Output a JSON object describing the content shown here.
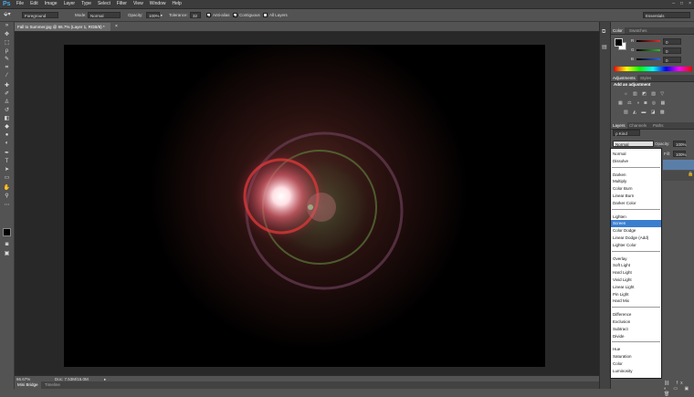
{
  "app": {
    "logo": "Ps"
  },
  "menu": [
    "File",
    "Edit",
    "Image",
    "Layer",
    "Type",
    "Select",
    "Filter",
    "View",
    "Window",
    "Help"
  ],
  "window_controls": [
    "–",
    "□",
    "×"
  ],
  "options": {
    "source_value": "Foreground",
    "mode_label": "Mode:",
    "mode_value": "Normal",
    "opacity_label": "Opacity:",
    "opacity_value": "100%",
    "tolerance_label": "Tolerance:",
    "tolerance_value": "32",
    "antialias_label": "Anti-alias",
    "contiguous_label": "Contiguous",
    "all_layers_label": "All Layers",
    "workspace_value": "Essentials"
  },
  "document": {
    "tab_title": "Fall to Summer.jpg @ 66.7% (Layer 1, RGB/8) *",
    "zoom": "66.67%",
    "doc_info": "Doc: 7.53M/15.0M"
  },
  "bottom_tabs": [
    "Mini Bridge",
    "Timeline"
  ],
  "color_panel": {
    "tabs": [
      "Color",
      "Swatches"
    ],
    "channels": [
      {
        "label": "R",
        "value": "0",
        "color": "#e03030"
      },
      {
        "label": "G",
        "value": "0",
        "color": "#30c030"
      },
      {
        "label": "B",
        "value": "0",
        "color": "#3060e0"
      }
    ]
  },
  "adjustments_panel": {
    "tabs": [
      "Adjustments",
      "Styles"
    ],
    "heading": "Add an adjustment"
  },
  "layers_panel": {
    "tabs": [
      "Layers",
      "Channels",
      "Paths"
    ],
    "kind_value": "ρ Kind",
    "blend_value": "Normal",
    "opacity_label": "Opacity:",
    "opacity_value": "100%",
    "fill_label": "Fill:",
    "fill_value": "100%"
  },
  "blend_modes": {
    "groups": [
      [
        "Normal",
        "Dissolve"
      ],
      [
        "Darken",
        "Multiply",
        "Color Burn",
        "Linear Burn",
        "Darker Color"
      ],
      [
        "Lighten",
        "Screen",
        "Color Dodge",
        "Linear Dodge (Add)",
        "Lighter Color"
      ],
      [
        "Overlay",
        "Soft Light",
        "Hard Light",
        "Vivid Light",
        "Linear Light",
        "Pin Light",
        "Hard Mix"
      ],
      [
        "Difference",
        "Exclusion",
        "Subtract",
        "Divide"
      ],
      [
        "Hue",
        "Saturation",
        "Color",
        "Luminosity"
      ]
    ],
    "selected": "Screen"
  }
}
